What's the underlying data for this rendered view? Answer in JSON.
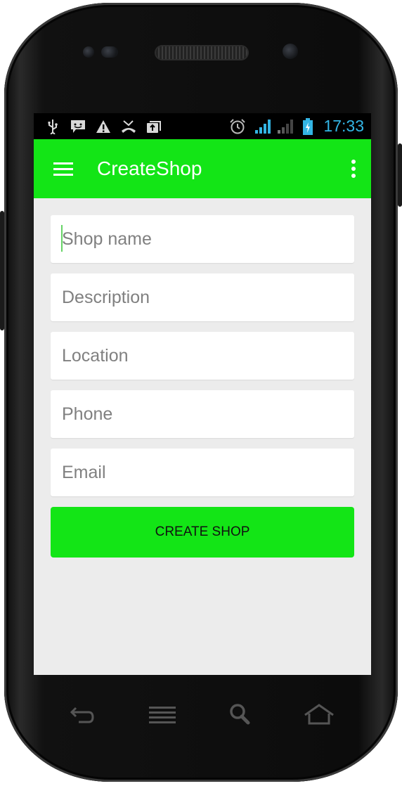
{
  "status_bar": {
    "time": "17:33",
    "icons": [
      "usb-icon",
      "sms-icon",
      "warning-icon",
      "missed-call-icon",
      "upload-icon",
      "alarm-icon",
      "signal-icon",
      "signal-weak-icon",
      "battery-charging-icon"
    ]
  },
  "app_bar": {
    "title": "CreateShop",
    "color": "#13e516",
    "menu_icon": "hamburger-menu-icon",
    "overflow_icon": "overflow-menu-icon"
  },
  "form": {
    "fields": [
      {
        "placeholder": "Shop name",
        "value": ""
      },
      {
        "placeholder": "Description",
        "value": ""
      },
      {
        "placeholder": "Location",
        "value": ""
      },
      {
        "placeholder": "Phone",
        "value": ""
      },
      {
        "placeholder": "Email",
        "value": ""
      }
    ],
    "submit_label": "CREATE SHOP",
    "submit_color": "#13e516"
  },
  "nav_bar": {
    "icons": [
      "back-icon",
      "menu-icon",
      "search-icon",
      "home-icon"
    ]
  }
}
